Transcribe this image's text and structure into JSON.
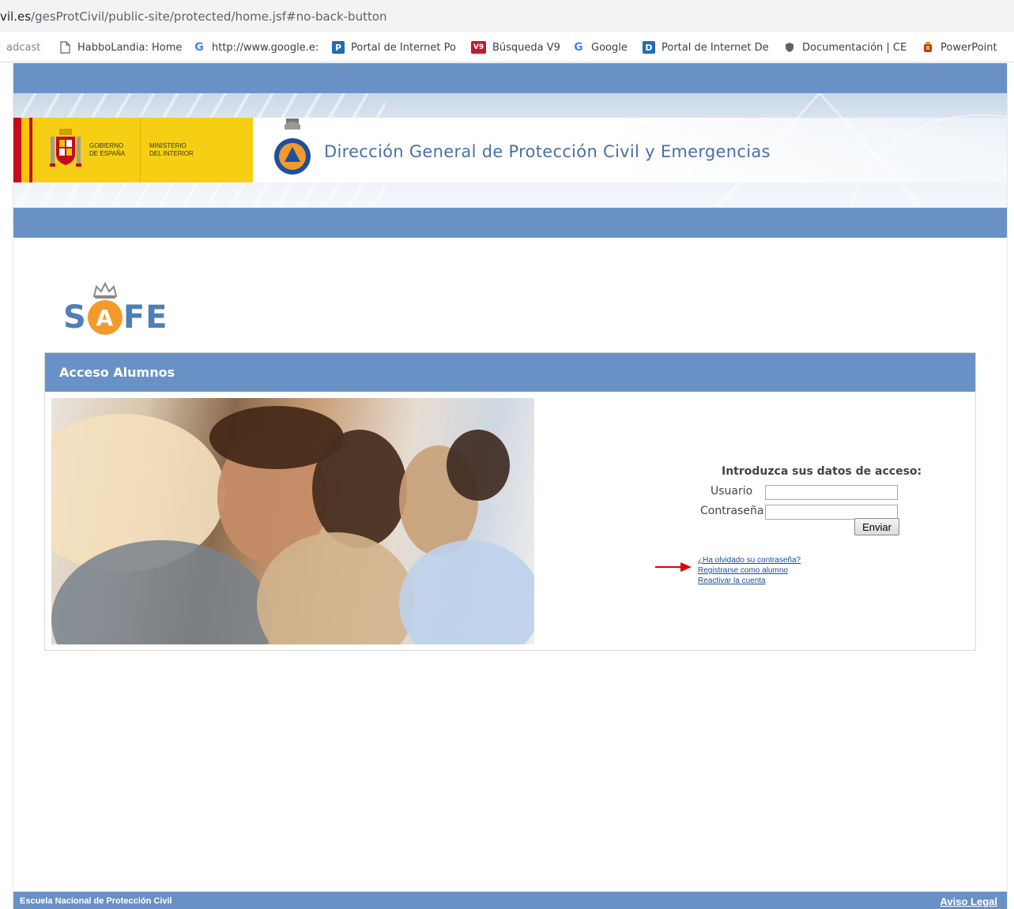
{
  "browser": {
    "url_host_suffix": "vil.es",
    "url_path": "/gesProtCivil/public-site/protected/home.jsf#no-back-button",
    "bookmarks": [
      {
        "label": "adcast",
        "icon": "none"
      },
      {
        "label": "HabboLandia: Home",
        "icon": "page-icon"
      },
      {
        "label": "http://www.google.e:",
        "icon": "google-icon"
      },
      {
        "label": "Portal de Internet Po",
        "icon": "p-icon"
      },
      {
        "label": "Búsqueda V9",
        "icon": "v9-icon"
      },
      {
        "label": "Google",
        "icon": "google-icon"
      },
      {
        "label": "Portal de Internet De",
        "icon": "d-icon"
      },
      {
        "label": "Documentación | CE",
        "icon": "shield-icon"
      },
      {
        "label": "PowerPoint",
        "icon": "coat-icon"
      }
    ]
  },
  "header": {
    "gov_line1": "GOBIERNO",
    "gov_line2": "DE ESPAÑA",
    "ministry_line1": "MINISTERIO",
    "ministry_line2": "DEL INTERIOR",
    "title": "Dirección General de Protección Civil y Emergencias"
  },
  "logo": {
    "s": "S",
    "a": "A",
    "fe": "FE"
  },
  "panel": {
    "title": "Acceso Alumnos",
    "heading": "Introduzca sus datos de acceso:",
    "user_label": "Usuario",
    "user_value": "",
    "password_label": "Contraseña",
    "password_value": "",
    "submit_label": "Enviar",
    "links": {
      "forgot": "¿Ha olvidado su contraseña?",
      "register": "Registrarse como alumno",
      "reactivate": "Reactivar la cuenta"
    }
  },
  "footer": {
    "left": "Escuela Nacional de Protección Civil",
    "right": "Aviso Legal"
  },
  "colors": {
    "brand_blue": "#6a91c6",
    "title_blue": "#4a6fa3",
    "gov_yellow": "#f6cf14",
    "safe_orange": "#f39a2b",
    "arrow_red": "#e00000"
  }
}
